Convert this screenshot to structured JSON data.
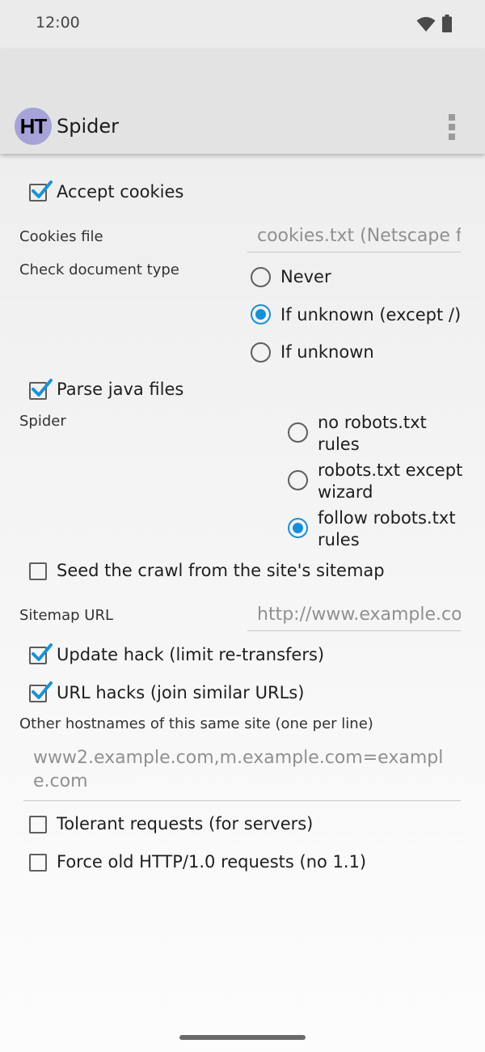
{
  "status_bar": {
    "time": "12:00"
  },
  "app_bar": {
    "logo_text": "HT",
    "title": "Spider"
  },
  "accept_cookies": {
    "label": "Accept cookies",
    "checked": true
  },
  "cookies_file": {
    "label": "Cookies file",
    "placeholder": "cookies.txt (Netscape format)"
  },
  "check_doc_type": {
    "label": "Check document type",
    "options": [
      {
        "label": "Never",
        "selected": false
      },
      {
        "label": "If unknown (except /)",
        "selected": true
      },
      {
        "label": "If unknown",
        "selected": false
      }
    ]
  },
  "parse_java": {
    "label": "Parse java files",
    "checked": true
  },
  "spider": {
    "label": "Spider",
    "options": [
      {
        "line1": "no robots.txt",
        "line2": "rules",
        "selected": false
      },
      {
        "line1": "robots.txt except",
        "line2": "wizard",
        "selected": false
      },
      {
        "line1": "follow robots.txt",
        "line2": "rules",
        "selected": true
      }
    ]
  },
  "seed_sitemap": {
    "label": "Seed the crawl from the site's sitemap",
    "checked": false
  },
  "sitemap_url": {
    "label": "Sitemap URL",
    "placeholder": "http://www.example.com/sitemap.xml"
  },
  "update_hack": {
    "label": "Update hack (limit re-transfers)",
    "checked": true
  },
  "url_hacks": {
    "label": "URL hacks (join similar URLs)",
    "checked": true
  },
  "other_hostnames": {
    "label": "Other hostnames of this same site (one per line)",
    "placeholder": "www2.example.com,m.example.com=example.com"
  },
  "tolerant_requests": {
    "label": "Tolerant requests (for servers)",
    "checked": false
  },
  "force_http10": {
    "label": "Force old HTTP/1.0 requests (no 1.1)",
    "checked": false
  },
  "colors": {
    "accent": "#1590d6",
    "app_bar": "#e3e3e3",
    "logo_bg": "#a5a3d8"
  }
}
